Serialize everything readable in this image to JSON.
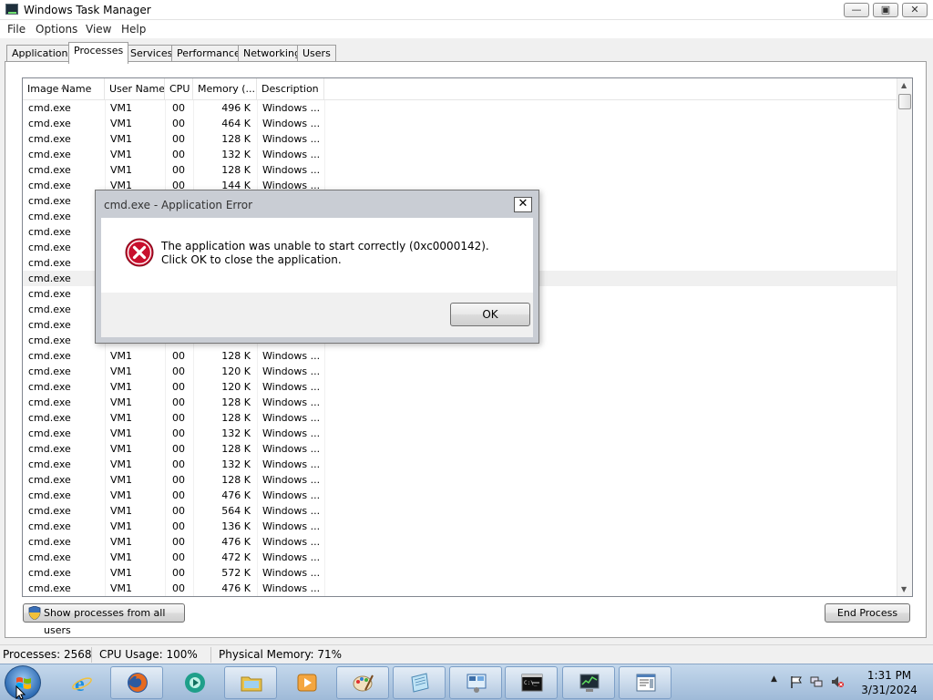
{
  "window": {
    "title": "Windows Task Manager",
    "controls": {
      "minimize": "—",
      "restore": "▣",
      "close": "✕"
    }
  },
  "menu": [
    "File",
    "Options",
    "View",
    "Help"
  ],
  "tabs": [
    "Applications",
    "Processes",
    "Services",
    "Performance",
    "Networking",
    "Users"
  ],
  "active_tab": "Processes",
  "columns": [
    "Image Name",
    "User Name",
    "CPU",
    "Memory (...",
    "Description"
  ],
  "processes": [
    {
      "image": "cmd.exe",
      "user": "VM1",
      "cpu": "00",
      "memory": "496 K",
      "description": "Windows ..."
    },
    {
      "image": "cmd.exe",
      "user": "VM1",
      "cpu": "00",
      "memory": "464 K",
      "description": "Windows ..."
    },
    {
      "image": "cmd.exe",
      "user": "VM1",
      "cpu": "00",
      "memory": "128 K",
      "description": "Windows ..."
    },
    {
      "image": "cmd.exe",
      "user": "VM1",
      "cpu": "00",
      "memory": "132 K",
      "description": "Windows ..."
    },
    {
      "image": "cmd.exe",
      "user": "VM1",
      "cpu": "00",
      "memory": "128 K",
      "description": "Windows ..."
    },
    {
      "image": "cmd.exe",
      "user": "VM1",
      "cpu": "00",
      "memory": "144 K",
      "description": "Windows ..."
    },
    {
      "image": "cmd.exe",
      "user": "",
      "cpu": "",
      "memory": "",
      "description": ""
    },
    {
      "image": "cmd.exe",
      "user": "",
      "cpu": "",
      "memory": "",
      "description": ""
    },
    {
      "image": "cmd.exe",
      "user": "",
      "cpu": "",
      "memory": "",
      "description": ""
    },
    {
      "image": "cmd.exe",
      "user": "",
      "cpu": "",
      "memory": "",
      "description": ""
    },
    {
      "image": "cmd.exe",
      "user": "",
      "cpu": "",
      "memory": "",
      "description": ""
    },
    {
      "image": "cmd.exe",
      "user": "",
      "cpu": "",
      "memory": "",
      "description": "",
      "selected": true
    },
    {
      "image": "cmd.exe",
      "user": "",
      "cpu": "",
      "memory": "",
      "description": ""
    },
    {
      "image": "cmd.exe",
      "user": "",
      "cpu": "",
      "memory": "",
      "description": ""
    },
    {
      "image": "cmd.exe",
      "user": "",
      "cpu": "",
      "memory": "",
      "description": ""
    },
    {
      "image": "cmd.exe",
      "user": "",
      "cpu": "",
      "memory": "",
      "description": ""
    },
    {
      "image": "cmd.exe",
      "user": "VM1",
      "cpu": "00",
      "memory": "128 K",
      "description": "Windows ..."
    },
    {
      "image": "cmd.exe",
      "user": "VM1",
      "cpu": "00",
      "memory": "120 K",
      "description": "Windows ..."
    },
    {
      "image": "cmd.exe",
      "user": "VM1",
      "cpu": "00",
      "memory": "120 K",
      "description": "Windows ..."
    },
    {
      "image": "cmd.exe",
      "user": "VM1",
      "cpu": "00",
      "memory": "128 K",
      "description": "Windows ..."
    },
    {
      "image": "cmd.exe",
      "user": "VM1",
      "cpu": "00",
      "memory": "128 K",
      "description": "Windows ..."
    },
    {
      "image": "cmd.exe",
      "user": "VM1",
      "cpu": "00",
      "memory": "132 K",
      "description": "Windows ..."
    },
    {
      "image": "cmd.exe",
      "user": "VM1",
      "cpu": "00",
      "memory": "128 K",
      "description": "Windows ..."
    },
    {
      "image": "cmd.exe",
      "user": "VM1",
      "cpu": "00",
      "memory": "132 K",
      "description": "Windows ..."
    },
    {
      "image": "cmd.exe",
      "user": "VM1",
      "cpu": "00",
      "memory": "128 K",
      "description": "Windows ..."
    },
    {
      "image": "cmd.exe",
      "user": "VM1",
      "cpu": "00",
      "memory": "476 K",
      "description": "Windows ..."
    },
    {
      "image": "cmd.exe",
      "user": "VM1",
      "cpu": "00",
      "memory": "564 K",
      "description": "Windows ..."
    },
    {
      "image": "cmd.exe",
      "user": "VM1",
      "cpu": "00",
      "memory": "136 K",
      "description": "Windows ..."
    },
    {
      "image": "cmd.exe",
      "user": "VM1",
      "cpu": "00",
      "memory": "476 K",
      "description": "Windows ..."
    },
    {
      "image": "cmd.exe",
      "user": "VM1",
      "cpu": "00",
      "memory": "472 K",
      "description": "Windows ..."
    },
    {
      "image": "cmd.exe",
      "user": "VM1",
      "cpu": "00",
      "memory": "572 K",
      "description": "Windows ..."
    },
    {
      "image": "cmd.exe",
      "user": "VM1",
      "cpu": "00",
      "memory": "476 K",
      "description": "Windows ..."
    }
  ],
  "buttons": {
    "show_all": "Show processes from all users",
    "end_process": "End Process"
  },
  "status": {
    "processes": "Processes: 2568",
    "cpu": "CPU Usage: 100%",
    "memory": "Physical Memory: 71%"
  },
  "dialog": {
    "title": "cmd.exe - Application Error",
    "close": "✕",
    "message": "The application was unable to start correctly (0xc0000142). Click OK to close the application.",
    "ok": "OK"
  },
  "taskbar": {
    "apps": [
      "internet-explorer-icon",
      "firefox-icon",
      "media-center-icon",
      "windows-explorer-icon",
      "media-player-icon",
      "paint-icon",
      "notepad-icon",
      "control-panel-icon",
      "command-prompt-icon",
      "task-manager-icon",
      "document-viewer-icon"
    ],
    "time": "1:31 PM",
    "date": "3/31/2024"
  },
  "colors": {
    "error_red": "#c8102e",
    "taskbar": "#a9c3e0",
    "selection": "#f0f0f0"
  }
}
